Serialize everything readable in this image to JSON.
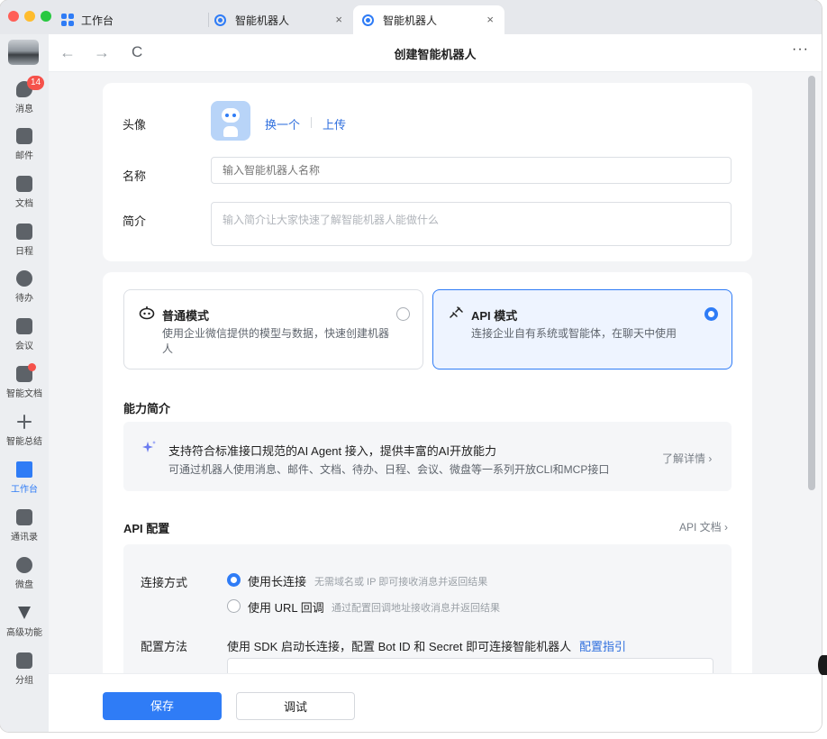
{
  "window": {
    "tabs": [
      {
        "label": "工作台"
      },
      {
        "label": "智能机器人"
      },
      {
        "label": "智能机器人"
      }
    ],
    "close_glyph": "×"
  },
  "toolbar": {
    "back": "←",
    "forward": "→",
    "refresh": "C",
    "title": "创建智能机器人",
    "more": "···"
  },
  "sidebar": {
    "items": [
      {
        "label": "消息",
        "icon": "chat-icon",
        "badge": "14"
      },
      {
        "label": "邮件",
        "icon": "mail-icon"
      },
      {
        "label": "文档",
        "icon": "doc-icon"
      },
      {
        "label": "日程",
        "icon": "calendar-icon"
      },
      {
        "label": "待办",
        "icon": "check-icon"
      },
      {
        "label": "会议",
        "icon": "meeting-icon"
      },
      {
        "label": "智能文档",
        "icon": "smart-doc-icon"
      },
      {
        "label": "智能总结",
        "icon": "sparkle-icon"
      },
      {
        "label": "工作台",
        "icon": "workbench-icon"
      },
      {
        "label": "通讯录",
        "icon": "contacts-icon"
      },
      {
        "label": "微盘",
        "icon": "drive-icon"
      },
      {
        "label": "高级功能",
        "icon": "advanced-icon"
      },
      {
        "label": "分组",
        "icon": "group-icon"
      }
    ]
  },
  "basic": {
    "avatar_label": "头像",
    "change": "换一个",
    "upload": "上传",
    "name_label": "名称",
    "name_placeholder": "输入智能机器人名称",
    "intro_label": "简介",
    "intro_placeholder": "输入简介让大家快速了解智能机器人能做什么"
  },
  "modes": [
    {
      "title": "普通模式",
      "desc": "使用企业微信提供的模型与数据，快速创建机器人",
      "selected": false
    },
    {
      "title": "API 模式",
      "desc": "连接企业自有系统或智能体，在聊天中使用",
      "selected": true
    }
  ],
  "capability": {
    "title": "能力简介",
    "main": "支持符合标准接口规范的AI Agent 接入，提供丰富的AI开放能力",
    "sub": "可通过机器人使用消息、邮件、文档、待办、日程、会议、微盘等一系列开放CLI和MCP接口",
    "more": "了解详情 ›"
  },
  "api": {
    "title": "API 配置",
    "doc_link": "API 文档 ›",
    "connect_label": "连接方式",
    "options": [
      {
        "label": "使用长连接",
        "hint": "无需域名或 IP 即可接收消息并返回结果",
        "selected": true
      },
      {
        "label": "使用 URL 回调",
        "hint": "通过配置回调地址接收消息并返回结果",
        "selected": false
      }
    ],
    "method_label": "配置方法",
    "method_text": "使用 SDK 启动长连接，配置 Bot ID 和 Secret 即可连接智能机器人",
    "method_link": "配置指引"
  },
  "footer": {
    "save": "保存",
    "debug": "调试"
  },
  "colors": {
    "accent": "#2f7cf6",
    "badge": "#f5524b"
  }
}
